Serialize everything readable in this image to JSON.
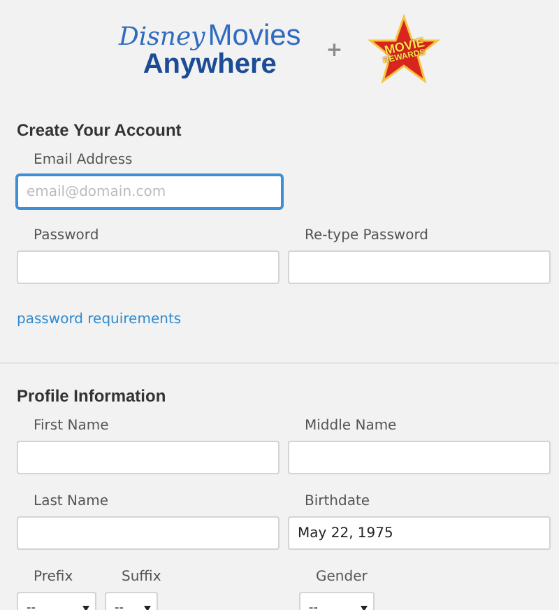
{
  "header": {
    "brand_script": "Disney",
    "brand_word": "Movies",
    "brand_sub": "Anywhere",
    "plus": "+",
    "badge_top": "MOVIE",
    "badge_bottom": "REWARDS"
  },
  "sections": [
    {
      "title": "Create Your Account",
      "rows": [
        [
          {
            "kind": "input",
            "label": "Email Address",
            "placeholder": "email@domain.com",
            "focused": true
          }
        ],
        [
          {
            "kind": "input",
            "label": "Password",
            "focused": false
          },
          {
            "kind": "input",
            "label": "Re-type Password",
            "focused": false
          }
        ]
      ],
      "link": "password requirements"
    },
    {
      "title": "Profile Information",
      "rows": [
        [
          {
            "kind": "input",
            "label": "First Name",
            "focused": false
          },
          {
            "kind": "input",
            "label": "Middle Name",
            "focused": false
          }
        ],
        [
          {
            "kind": "input",
            "label": "Last Name",
            "focused": false
          },
          {
            "kind": "input",
            "label": "Birthdate",
            "value": "May 22, 1975",
            "focused": false
          }
        ],
        [
          {
            "kind": "select",
            "label": "Prefix",
            "value": "--"
          },
          {
            "kind": "select",
            "label": "Suffix",
            "value": "--"
          },
          {
            "kind": "spacer"
          },
          {
            "kind": "select",
            "label": "Gender",
            "value": "--"
          }
        ]
      ]
    }
  ]
}
